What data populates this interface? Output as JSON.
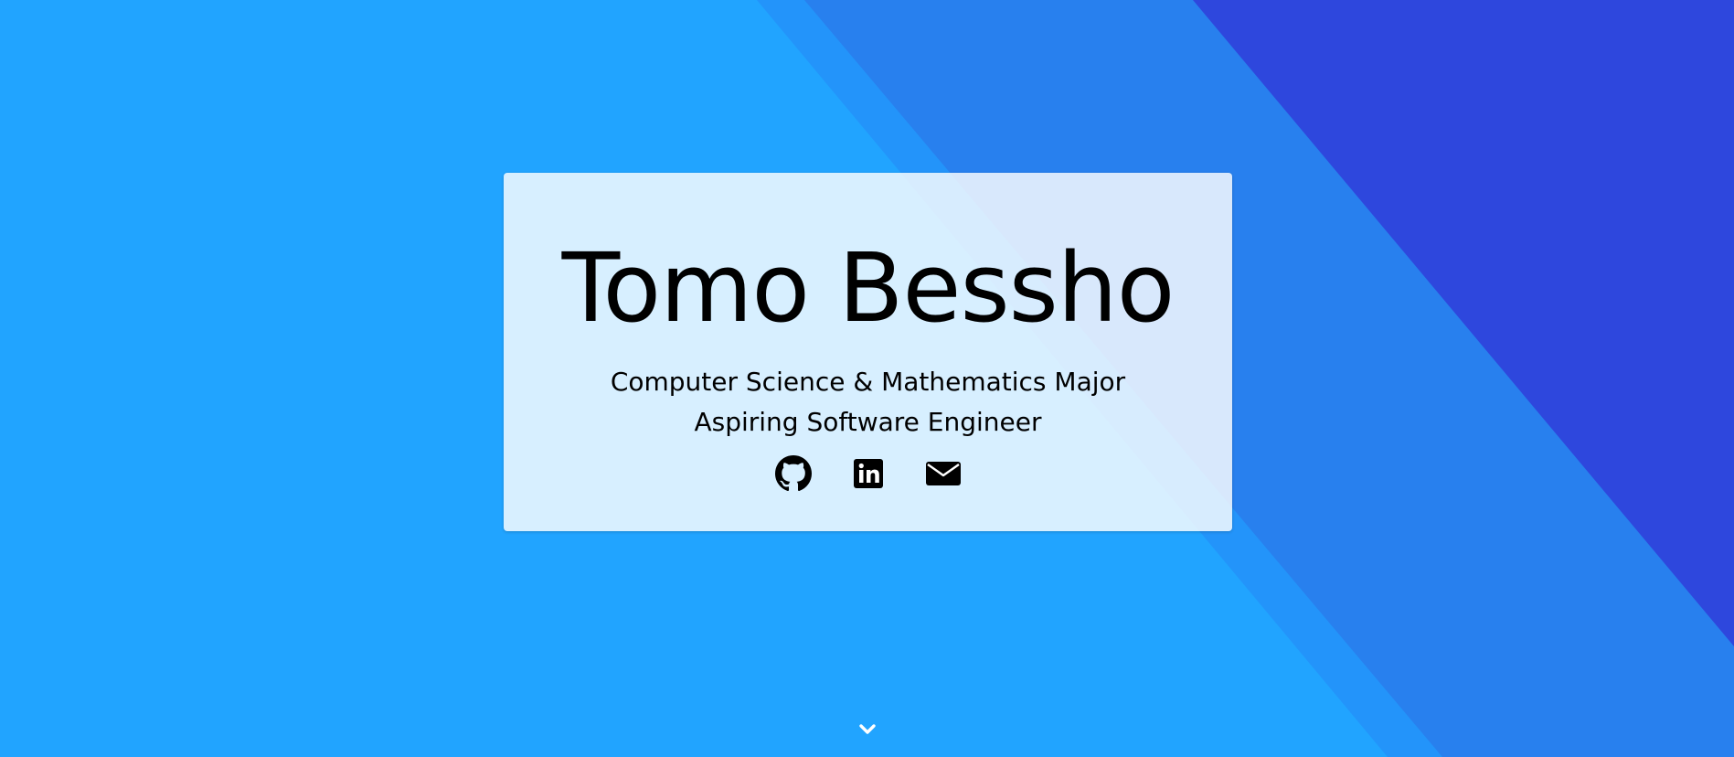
{
  "hero": {
    "name": "Tomo Bessho",
    "subtitle_line1": "Computer Science & Mathematics Major",
    "subtitle_line2": "Aspiring Software Engineer"
  },
  "social_links": [
    {
      "icon": "github-icon",
      "label": "GitHub"
    },
    {
      "icon": "linkedin-icon",
      "label": "LinkedIn"
    },
    {
      "icon": "envelope-icon",
      "label": "Email"
    }
  ],
  "scroll_indicator": {
    "icon": "chevron-down-icon"
  },
  "colors": {
    "background": "#21a4ff",
    "stripe_middle": "#2880ee",
    "stripe_dark": "#2e47dd",
    "card": "#d4ecff",
    "text": "#000000",
    "chevron": "#ffffff"
  }
}
